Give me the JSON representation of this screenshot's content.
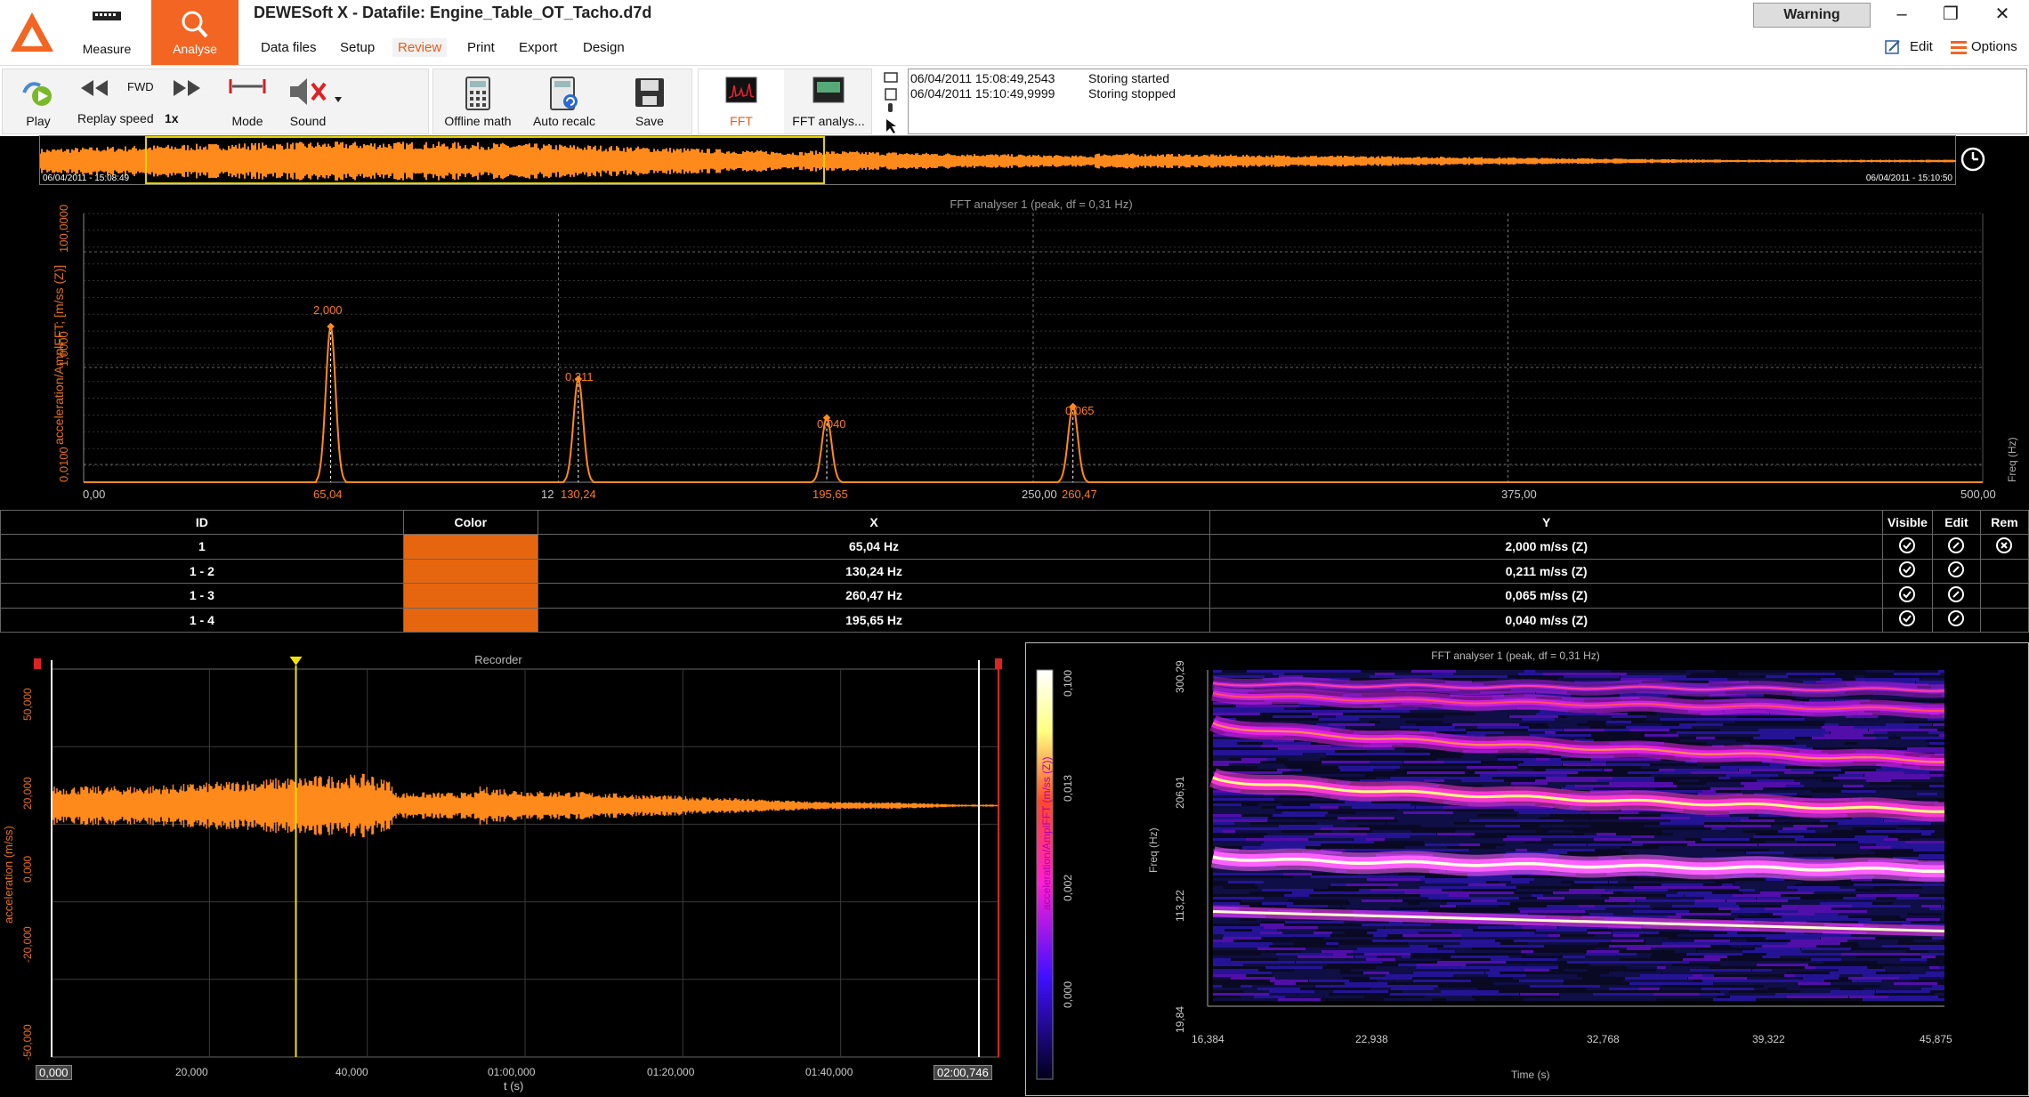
{
  "window": {
    "title": "DEWESoft X - Datafile: Engine_Table_OT_Tacho.d7d",
    "warning": "Warning",
    "min_glyph": "–",
    "max_glyph": "❐",
    "close_glyph": "✕"
  },
  "modes": {
    "measure": "Measure",
    "analyse": "Analyse"
  },
  "menu": [
    "Data files",
    "Setup",
    "Review",
    "Print",
    "Export",
    "Design"
  ],
  "top_right": {
    "edit": "Edit",
    "options": "Options"
  },
  "toolbar": {
    "play": "Play",
    "fwd": "FWD",
    "replay_speed": "Replay speed",
    "replay_value": "1x",
    "mode": "Mode",
    "sound": "Sound",
    "offline_math": "Offline math",
    "auto_recalc": "Auto recalc",
    "save": "Save",
    "fft": "FFT",
    "fft_analyser": "FFT analys..."
  },
  "log": [
    {
      "time": "06/04/2011 15:08:49,2543",
      "msg": "Storing started"
    },
    {
      "time": "06/04/2011 15:10:49,9999",
      "msg": "Storing stopped"
    }
  ],
  "overview": {
    "start": "06/04/2011 - 15:08:49",
    "end": "06/04/2011 - 15:10:50"
  },
  "fft": {
    "title": "FFT analyser 1 (peak, df = 0,31 Hz)",
    "ylabel": "acceleration/AmplFFT; [m/ss (Z)]",
    "right_label": "Freq (Hz)",
    "y_ticks": [
      "100,0000",
      "1,0000",
      "0,0100"
    ],
    "x_ticks": [
      "0,00",
      "65,04",
      "12",
      "130,24",
      "195,65",
      "250,00",
      "260,47",
      "375,00",
      "500,00"
    ],
    "peaks": [
      {
        "label": "2,000",
        "freq": 65.04,
        "value": 2.0
      },
      {
        "label": "0,211",
        "freq": 130.24,
        "value": 0.211
      },
      {
        "label": "0,040",
        "freq": 195.65,
        "value": 0.04
      },
      {
        "label": "0,065",
        "freq": 260.47,
        "value": 0.065
      }
    ]
  },
  "table": {
    "headers": [
      "ID",
      "Color",
      "X",
      "Y",
      "Visible",
      "Edit",
      "Rem"
    ],
    "rows": [
      {
        "id": "1",
        "x": "65,04 Hz",
        "y": "2,000 m/ss (Z)"
      },
      {
        "id": "1 - 2",
        "x": "130,24 Hz",
        "y": "0,211 m/ss (Z)"
      },
      {
        "id": "1 - 3",
        "x": "260,47 Hz",
        "y": "0,065 m/ss (Z)"
      },
      {
        "id": "1 - 4",
        "x": "195,65 Hz",
        "y": "0,040 m/ss (Z)"
      }
    ],
    "swatch_color": "#e66610"
  },
  "recorder": {
    "title": "Recorder",
    "ylabel": "acceleration (m/ss)",
    "xlabel": "t (s)",
    "y_ticks": [
      "50,000",
      "20,000",
      "0,000",
      "-20,000",
      "-50,000"
    ],
    "x_ticks": [
      "0,000",
      "20,000",
      "40,000",
      "01:00,000",
      "01:20,000",
      "01:40,000",
      "02:00,746"
    ]
  },
  "spectrogram": {
    "title": "FFT analyser 1 (peak, df = 0,31 Hz)",
    "colorbar_label": "acceleration/AmplFFT (m/ss (Z))",
    "colorbar_ticks": [
      "0,100",
      "0,013",
      "0,002",
      "0,000"
    ],
    "ylabel": "Freq (Hz)",
    "xlabel": "Time (s)",
    "y_ticks": [
      "300,29",
      "206,91",
      "113,22",
      "19,84"
    ],
    "x_ticks": [
      "16,384",
      "22,938",
      "32,768",
      "39,322",
      "45,875"
    ]
  },
  "colors": {
    "accent": "#f26522",
    "signal": "#ff8a1c",
    "cursor": "#f2e200"
  }
}
